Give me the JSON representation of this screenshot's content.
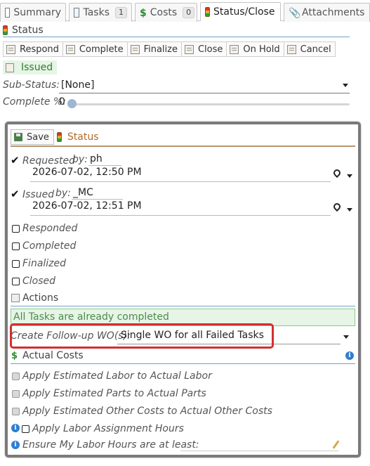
{
  "tabs": [
    {
      "label": "Summary"
    },
    {
      "label": "Tasks",
      "badge": "1"
    },
    {
      "label": "Costs",
      "badge": "0"
    },
    {
      "label": "Status/Close"
    },
    {
      "label": "Attachments"
    }
  ],
  "section_title": "Status",
  "actions": [
    "Respond",
    "Complete",
    "Finalize",
    "Close",
    "On Hold",
    "Cancel"
  ],
  "status_badge": "Issued",
  "sub_status": {
    "label": "Sub-Status:",
    "value": "[None]"
  },
  "complete": {
    "label": "Complete %:",
    "value": "0",
    "percent": 0
  },
  "dialog": {
    "save_label": "Save",
    "title": "Status",
    "requested": {
      "label": "Requested",
      "by_label": "by:",
      "by_value": "ph",
      "datetime": "2026-07-02, 12:50 PM",
      "checked": true
    },
    "issued": {
      "label": "Issued",
      "by_label": "by:",
      "by_value": "_MC",
      "datetime": "2026-07-02, 12:51 PM",
      "checked": true
    },
    "states": [
      "Responded",
      "Completed",
      "Finalized",
      "Closed"
    ],
    "actions_section": "Actions",
    "notice": "All Tasks are already completed",
    "followup": {
      "label": "Create Follow-up WO(s):",
      "value": "Single WO for all Failed Tasks"
    },
    "costs_section": "Actual Costs",
    "cost_options": [
      "Apply Estimated Labor to Actual Labor",
      "Apply Estimated Parts to Actual Parts",
      "Apply Estimated Other Costs to Actual Other Costs"
    ],
    "labor_assignment": "Apply Labor Assignment Hours",
    "ensure_hours": "Ensure My Labor Hours are at least:"
  }
}
